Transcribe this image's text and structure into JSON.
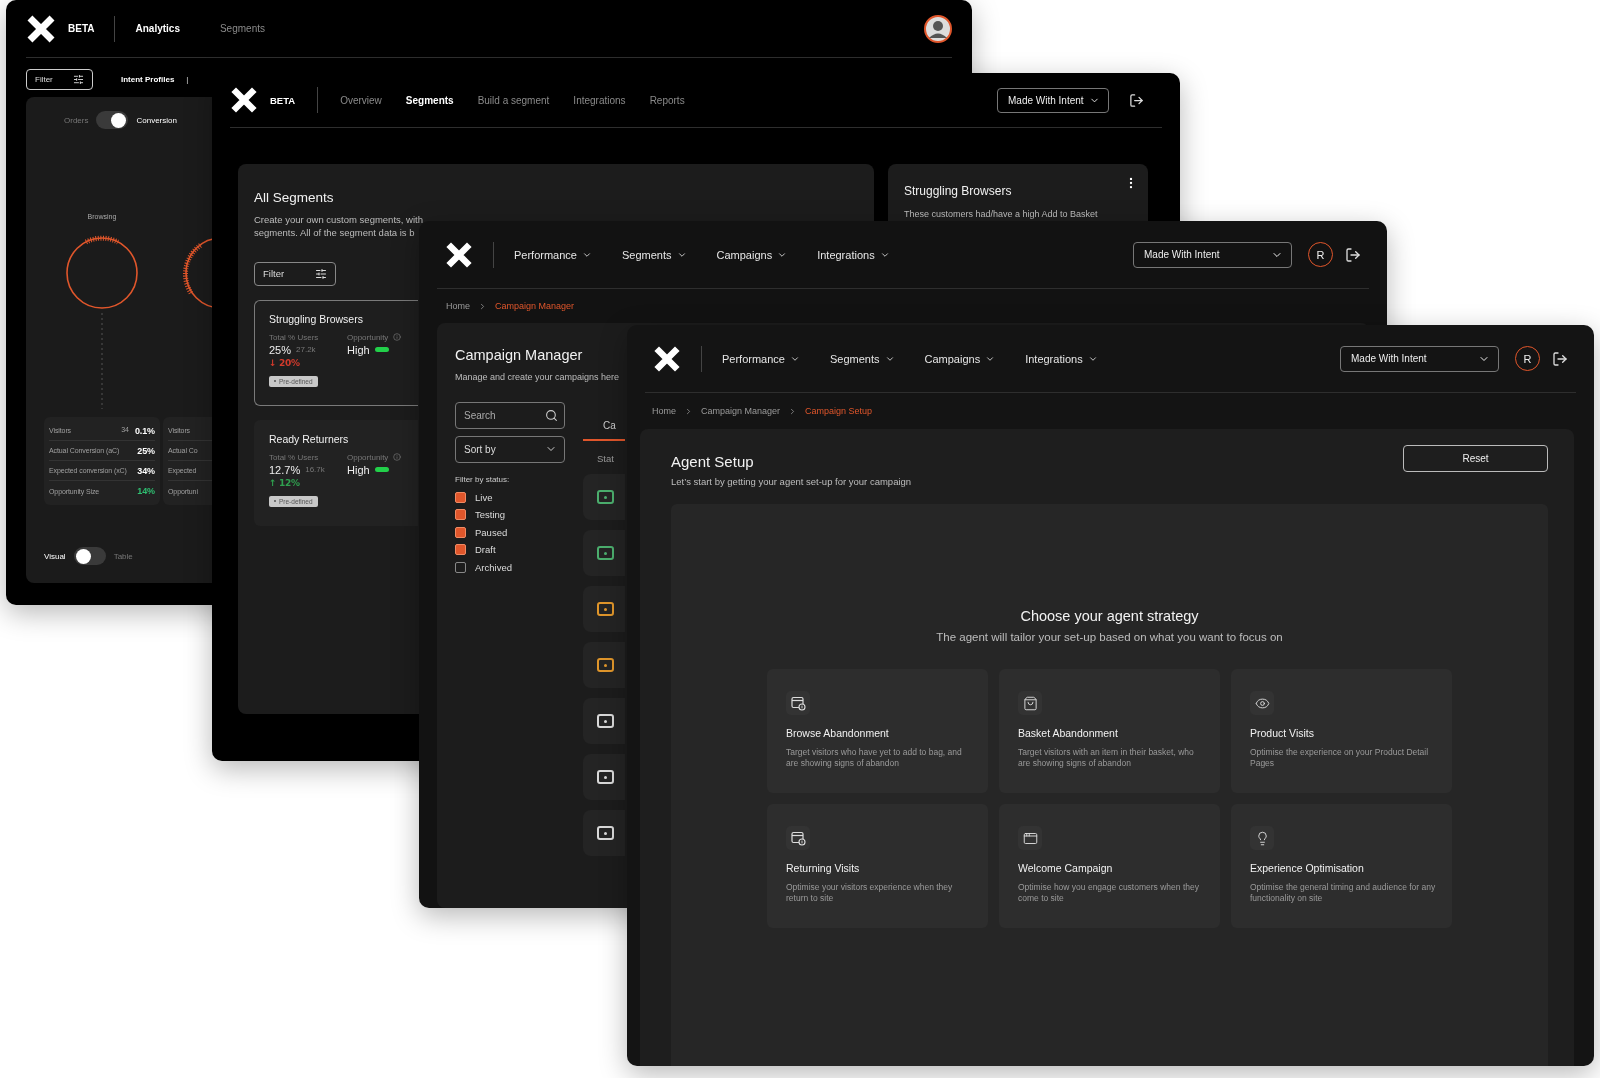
{
  "analytics_window": {
    "logo_badge": "BETA",
    "nav": [
      {
        "label": "Analytics",
        "selected": true
      },
      {
        "label": "Segments",
        "selected": false
      }
    ],
    "filter_button": "Filter",
    "subnav": [
      {
        "label": "Intent Profiles",
        "selected": true
      }
    ],
    "subnav_separator": "|",
    "metric_toggle": {
      "left": "Orders",
      "right": "Conversion",
      "on": true
    },
    "chart_label": "Browsing",
    "stats": [
      {
        "rows": [
          {
            "label": "Visitors",
            "count": "34",
            "value": "0.1%",
            "color": "#ffffff"
          },
          {
            "label": "Actual Conversion (aC)",
            "value": "25%",
            "color": "#ffffff"
          },
          {
            "label": "Expected conversion (xC)",
            "value": "34%",
            "color": "#ffffff"
          },
          {
            "label": "Opportunity Size",
            "value": "14%",
            "color": "#2fbf71"
          }
        ]
      },
      {
        "rows": [
          {
            "label": "Visitors"
          },
          {
            "label": "Actual Co"
          },
          {
            "label": "Expected"
          },
          {
            "label": "Opportuni"
          }
        ]
      }
    ],
    "view_toggle": {
      "left": "Visual",
      "right": "Table",
      "on": false
    }
  },
  "segments_window": {
    "logo_badge": "BETA",
    "nav": [
      {
        "label": "Overview",
        "selected": false
      },
      {
        "label": "Segments",
        "selected": true
      },
      {
        "label": "Build a segment",
        "selected": false
      },
      {
        "label": "Integrations",
        "selected": false
      },
      {
        "label": "Reports",
        "selected": false
      }
    ],
    "account_select": "Made With Intent",
    "panel": {
      "title": "All Segments",
      "description_lines": [
        "Create your own custom segments, with",
        "segments. All of the segment data is b"
      ],
      "filter_button": "Filter"
    },
    "segments": [
      {
        "name": "Struggling Browsers",
        "users_label": "Total % Users",
        "users": "25%",
        "count": "27.2k",
        "change": "↓ 20%",
        "color": "#d23a2c",
        "opportunity_label": "Opportunity",
        "opportunity": "High",
        "tag": "Pre-defined",
        "selected": true
      },
      {
        "name": "Ready Returners",
        "users_label": "Total % Users",
        "users": "12.7%",
        "count": "16.7k",
        "change": "↑ 12%",
        "color": "#2fa04f",
        "opportunity_label": "Opportunity",
        "opportunity": "High",
        "tag": "Pre-defined",
        "selected": false
      }
    ],
    "detail": {
      "title": "Struggling Browsers",
      "text": "These customers had/have a high Add to Basket"
    }
  },
  "campaign_manager_window": {
    "nav": [
      "Performance",
      "Segments",
      "Campaigns",
      "Integrations"
    ],
    "account_select": "Made With Intent",
    "avatar": "R",
    "breadcrumb": [
      {
        "label": "Home",
        "current": false
      },
      {
        "label": "Campaign Manager",
        "current": true
      }
    ],
    "title": "Campaign Manager",
    "subtitle": "Manage and create your campaigns here",
    "search": {
      "placeholder": "Search"
    },
    "sort": "Sort by",
    "filter_label": "Filter by status:",
    "statuses": [
      {
        "label": "Live",
        "checked": true
      },
      {
        "label": "Testing",
        "checked": true
      },
      {
        "label": "Paused",
        "checked": true
      },
      {
        "label": "Draft",
        "checked": true
      },
      {
        "label": "Archived",
        "checked": false
      }
    ],
    "tab": {
      "label": "Ca",
      "selected": true
    },
    "column_header": "Stat",
    "rows": [
      {
        "color": "#4caf6e"
      },
      {
        "color": "#4caf6e"
      },
      {
        "color": "#e0962b"
      },
      {
        "color": "#e0962b"
      },
      {
        "color": "#d9d9d9"
      },
      {
        "color": "#d9d9d9"
      },
      {
        "color": "#d9d9d9"
      }
    ]
  },
  "agent_setup_window": {
    "nav": [
      "Performance",
      "Segments",
      "Campaigns",
      "Integrations"
    ],
    "account_select": "Made With Intent",
    "avatar": "R",
    "breadcrumb": [
      {
        "label": "Home",
        "current": false
      },
      {
        "label": "Campaign Manager",
        "current": false
      },
      {
        "label": "Campaign Setup",
        "current": true
      }
    ],
    "title": "Agent Setup",
    "subtitle": "Let’s start by getting your agent set-up for your campaign",
    "reset_button": "Reset",
    "strategy_title": "Choose your agent strategy",
    "strategy_subtitle": "The agent will tailor your set-up based on what you want to focus on",
    "strategies": [
      {
        "kind": "browser",
        "title": "Browse Abandonment",
        "description": "Target visitors who have yet to add to bag, and are showing signs of abandon"
      },
      {
        "kind": "basket",
        "title": "Basket Abandonment",
        "description": "Target visitors with an item in their basket, who are showing signs of abandon"
      },
      {
        "kind": "eye",
        "title": "Product Visits",
        "description": "Optimise the experience on your Product Detail Pages"
      },
      {
        "kind": "browser",
        "title": "Returning Visits",
        "description": "Optimise your visitors experience when they return to site"
      },
      {
        "kind": "window",
        "title": "Welcome Campaign",
        "description": "Optimise how you engage customers when they come to site"
      },
      {
        "kind": "bulb",
        "title": "Experience Optimisation",
        "description": "Optimise the general timing and audience for any functionality on site"
      }
    ]
  }
}
